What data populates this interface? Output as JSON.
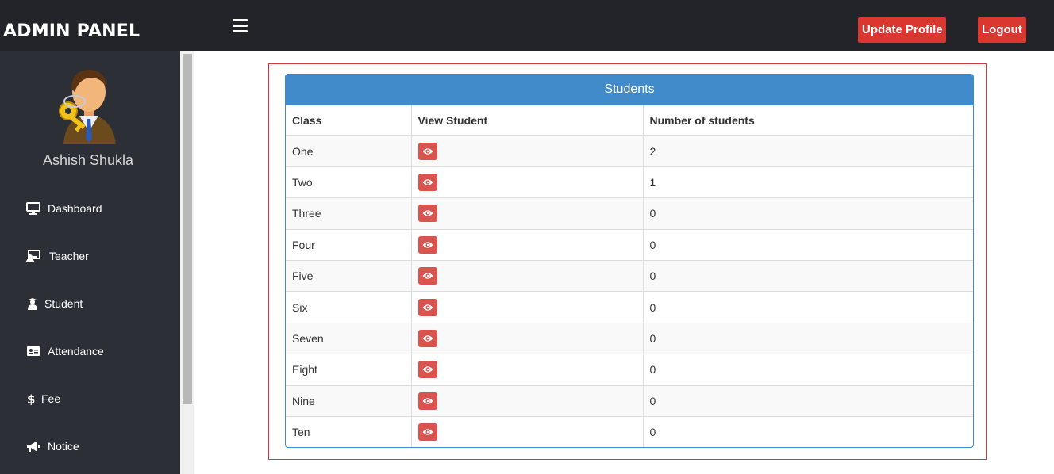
{
  "header": {
    "brand": "ADMIN PANEL",
    "update_profile_label": "Update Profile",
    "logout_label": "Logout"
  },
  "sidebar": {
    "username": "Ashish Shukla",
    "items": [
      {
        "label": "Dashboard",
        "icon": "monitor-icon"
      },
      {
        "label": "Teacher",
        "icon": "teacher-icon"
      },
      {
        "label": "Student",
        "icon": "student-icon"
      },
      {
        "label": "Attendance",
        "icon": "id-card-icon"
      },
      {
        "label": "Fee",
        "icon": "dollar-icon"
      },
      {
        "label": "Notice",
        "icon": "bullhorn-icon"
      }
    ]
  },
  "panel": {
    "title": "Students",
    "columns": [
      "Class",
      "View Student",
      "Number of students"
    ],
    "rows": [
      {
        "class": "One",
        "count": "2"
      },
      {
        "class": "Two",
        "count": "1"
      },
      {
        "class": "Three",
        "count": "0"
      },
      {
        "class": "Four",
        "count": "0"
      },
      {
        "class": "Five",
        "count": "0"
      },
      {
        "class": "Six",
        "count": "0"
      },
      {
        "class": "Seven",
        "count": "0"
      },
      {
        "class": "Eight",
        "count": "0"
      },
      {
        "class": "Nine",
        "count": "0"
      },
      {
        "class": "Ten",
        "count": "0"
      }
    ]
  },
  "colors": {
    "topbar": "#222429",
    "sidebar": "#2c2f36",
    "accent_red": "#d9372f",
    "panel_blue": "#428bca",
    "view_button": "#d9534f"
  }
}
